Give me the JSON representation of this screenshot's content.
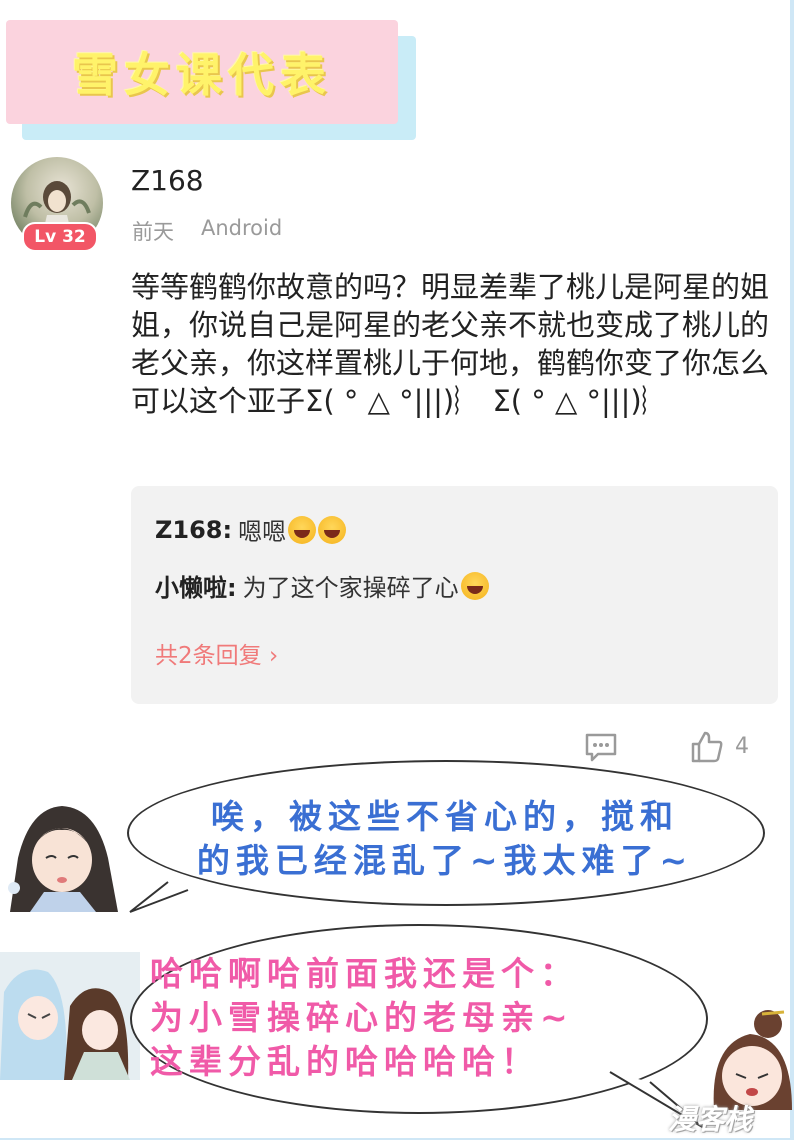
{
  "banner": {
    "title": "雪女课代表"
  },
  "comment": {
    "username": "Z168",
    "level": "Lv 32",
    "time": "前天",
    "device": "Android",
    "text": "等等鹤鹤你故意的吗？明显差辈了桃儿是阿星的姐姐，你说自己是阿星的老父亲不就也变成了桃儿的老父亲，你这样置桃儿于何地，鹤鹤你变了你怎么可以这个亚子Σ( ° △ °|||)︴ Σ( ° △ °|||)︴",
    "replies": [
      {
        "user": "Z168:",
        "text": "嗯嗯"
      },
      {
        "user": "小懒啦:",
        "text": "为了这个家操碎了心"
      }
    ],
    "more_replies": "共2条回复 ›",
    "like_count": "4"
  },
  "bubbles": {
    "top_line1": "唉，被这些不省心的，搅和",
    "top_line2": "的我已经混乱了~我太难了~",
    "bottom_line1": "哈哈啊哈前面我还是个：",
    "bottom_line2": "为小雪操碎心的老母亲~",
    "bottom_line3": "这辈分乱的哈哈哈哈！"
  },
  "watermark": "漫客栈",
  "icons": [
    "comment-icon",
    "thumbs-up-icon"
  ]
}
